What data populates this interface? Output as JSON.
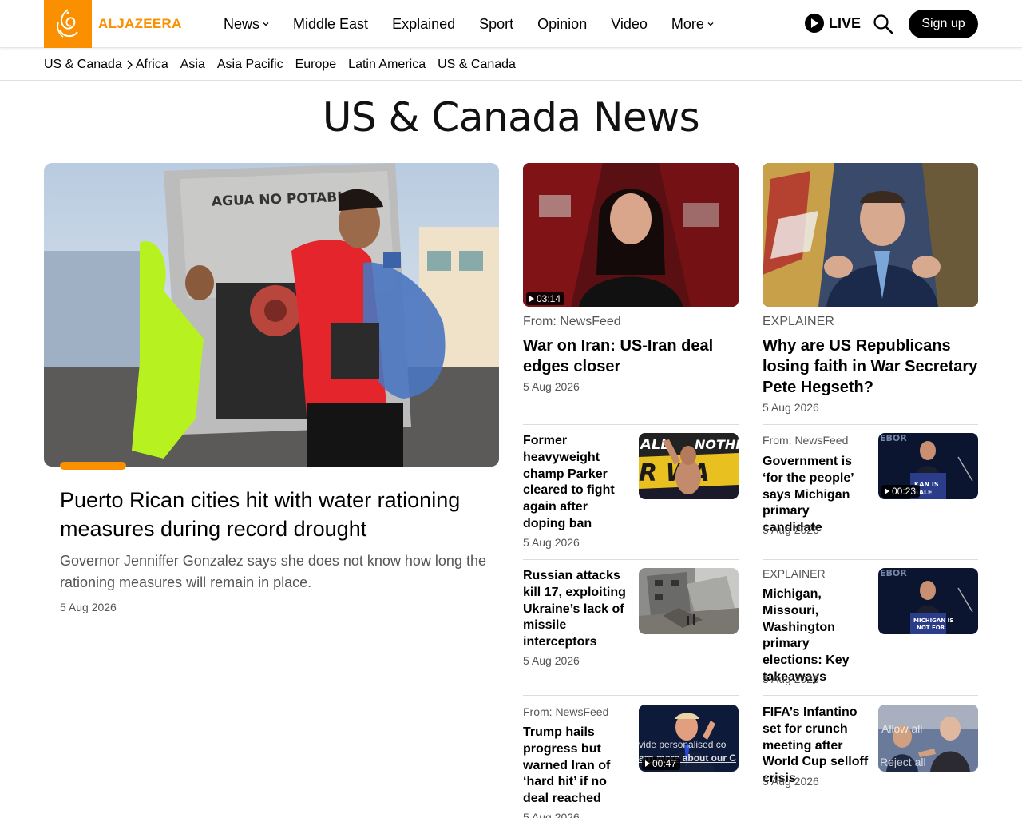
{
  "brand": {
    "name": "ALJAZEERA",
    "color": "#fa9000"
  },
  "nav": {
    "items": [
      {
        "label": "News",
        "has_dropdown": true
      },
      {
        "label": "Middle East",
        "has_dropdown": false
      },
      {
        "label": "Explained",
        "has_dropdown": false
      },
      {
        "label": "Sport",
        "has_dropdown": false
      },
      {
        "label": "Opinion",
        "has_dropdown": false
      },
      {
        "label": "Video",
        "has_dropdown": false
      },
      {
        "label": "More",
        "has_dropdown": true
      }
    ],
    "live_label": "LIVE",
    "signup_label": "Sign up"
  },
  "subnav": {
    "current": "US & Canada",
    "items": [
      "Africa",
      "Asia",
      "Asia Pacific",
      "Europe",
      "Latin America",
      "US & Canada"
    ]
  },
  "page": {
    "title": "US & Canada News"
  },
  "featured": {
    "title": "Puerto Rican cities hit with water rationing measures during record drought",
    "description": "Governor Jenniffer Gonzalez says she does not know how long the rationing measures will remain in place.",
    "date": "5 Aug 2026",
    "image_text": "AGUA NO POTABLE"
  },
  "top_cards": [
    {
      "kicker": "From: NewsFeed",
      "title": "War on Iran: US-Iran deal edges closer",
      "date": "5 Aug 2026",
      "duration": "03:14"
    },
    {
      "kicker": "EXPLAINER",
      "title": "Why are US Republicans losing faith in War Secretary Pete Hegseth?",
      "date": "5 Aug 2026"
    }
  ],
  "list_left": [
    {
      "title": "Former heavyweight champ Parker cleared to fight again after doping ban",
      "date": "5 Aug 2026"
    },
    {
      "title": "Russian attacks kill 17, exploiting Ukraine’s lack of missile interceptors",
      "date": "5 Aug 2026"
    },
    {
      "kicker": "From: NewsFeed",
      "title": "Trump hails progress but warned Iran of ‘hard hit’ if no deal reached",
      "date": "5 Aug 2026",
      "duration": "00:47"
    }
  ],
  "list_right": [
    {
      "kicker": "From: NewsFeed",
      "title": "Government is ‘for the people’ says Michigan primary candidate",
      "date": "5 Aug 2026",
      "duration": "00:23"
    },
    {
      "kicker": "EXPLAINER",
      "title": "Michigan, Missouri, Washington primary elections: Key takeaways",
      "date": "5 Aug 2026"
    },
    {
      "title": "FIFA’s Infantino set for crunch meeting after World Cup selloff crisis",
      "date": "5 Aug 2026"
    }
  ],
  "cookie": {
    "text_line1": "vide personalised co",
    "text_line2": "arn more about our C",
    "allow_label": "Allow all",
    "reject_label": "Reject all"
  }
}
